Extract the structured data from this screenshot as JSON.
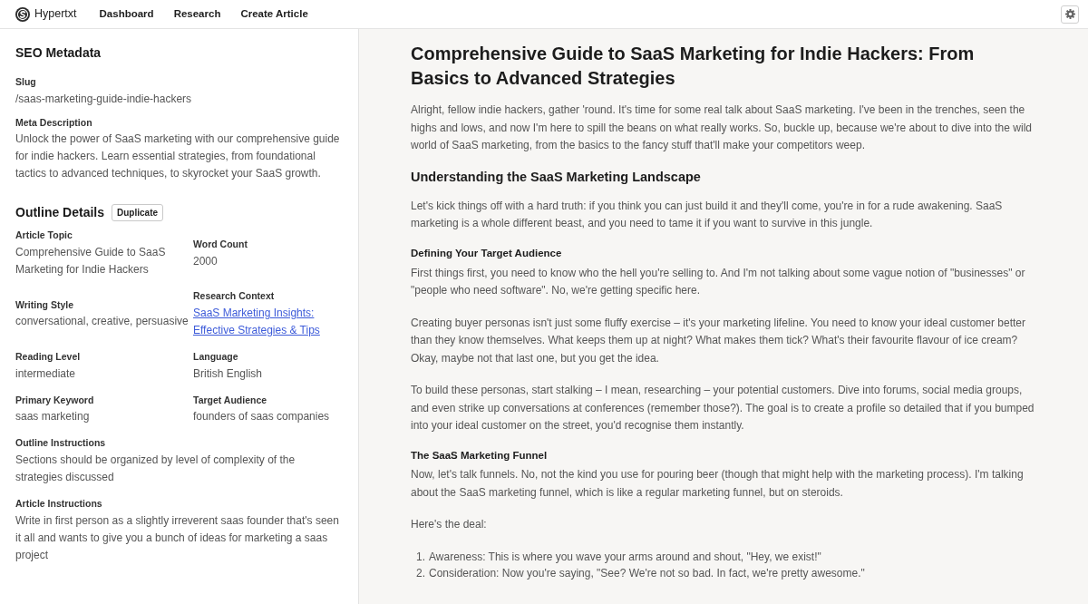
{
  "navbar": {
    "brand": "Hypertxt",
    "links": [
      {
        "label": "Dashboard"
      },
      {
        "label": "Research"
      },
      {
        "label": "Create Article"
      }
    ]
  },
  "seo_metadata": {
    "title": "SEO Metadata",
    "fields": [
      {
        "label": "Slug",
        "value": "/saas-marketing-guide-indie-hackers",
        "kind": "text"
      },
      {
        "label": "Meta Description",
        "value": "Unlock the power of SaaS marketing with our comprehensive guide for indie hackers. Learn essential strategies, from foundational tactics to advanced techniques, to skyrocket your SaaS growth.",
        "kind": "text"
      }
    ]
  },
  "outline_details": {
    "title": "Outline Details",
    "action": "Duplicate",
    "rows": [
      {
        "fields": [
          {
            "label": "Article Topic",
            "value": "Comprehensive Guide to SaaS Marketing for Indie Hackers",
            "kind": "text"
          },
          {
            "label": "Word Count",
            "value": "2000",
            "kind": "text"
          }
        ]
      },
      {
        "fields": [
          {
            "label": "Writing Style",
            "value": "conversational, creative, persuasive",
            "kind": "text"
          },
          {
            "label": "Research Context",
            "value": "SaaS Marketing Insights: Effective Strategies & Tips",
            "kind": "link"
          }
        ]
      },
      {
        "fields": [
          {
            "label": "Reading Level",
            "value": "intermediate",
            "kind": "text"
          },
          {
            "label": "Language",
            "value": "British English",
            "kind": "text"
          }
        ]
      },
      {
        "fields": [
          {
            "label": "Primary Keyword",
            "value": "saas marketing",
            "kind": "text"
          },
          {
            "label": "Target Audience",
            "value": "founders of saas companies",
            "kind": "text"
          }
        ]
      },
      {
        "fields": [
          {
            "label": "Outline Instructions",
            "value": "Sections should be organized by level of complexity of the strategies discussed",
            "kind": "text"
          }
        ]
      },
      {
        "fields": [
          {
            "label": "Article Instructions",
            "value": "Write in first person as a slightly irreverent saas founder that's seen it all and wants to give you a bunch of ideas for marketing a saas project",
            "kind": "text"
          }
        ]
      }
    ]
  },
  "article": {
    "title": "Comprehensive Guide to SaaS Marketing for Indie Hackers: From Basics to Advanced Strategies",
    "blocks": [
      {
        "kind": "paragraph",
        "text": "Alright, fellow indie hackers, gather 'round. It's time for some real talk about SaaS marketing. I've been in the trenches, seen the highs and lows, and now I'm here to spill the beans on what really works. So, buckle up, because we're about to dive into the wild world of SaaS marketing, from the basics to the fancy stuff that'll make your competitors weep."
      },
      {
        "kind": "heading",
        "text": "Understanding the SaaS Marketing Landscape"
      },
      {
        "kind": "paragraph",
        "text": "Let's kick things off with a hard truth: if you think you can just build it and they'll come, you're in for a rude awakening. SaaS marketing is a whole different beast, and you need to tame it if you want to survive in this jungle."
      },
      {
        "kind": "subheading",
        "text": "Defining Your Target Audience"
      },
      {
        "kind": "paragraph",
        "text": "First things first, you need to know who the hell you're selling to. And I'm not talking about some vague notion of \"businesses\" or \"people who need software\". No, we're getting specific here."
      },
      {
        "kind": "paragraph",
        "text": "Creating buyer personas isn't just some fluffy exercise – it's your marketing lifeline. You need to know your ideal customer better than they know themselves. What keeps them up at night? What makes them tick? What's their favourite flavour of ice cream? Okay, maybe not that last one, but you get the idea."
      },
      {
        "kind": "paragraph",
        "text": "To build these personas, start stalking – I mean, researching – your potential customers. Dive into forums, social media groups, and even strike up conversations at conferences (remember those?). The goal is to create a profile so detailed that if you bumped into your ideal customer on the street, you'd recognise them instantly."
      },
      {
        "kind": "subheading",
        "text": "The SaaS Marketing Funnel"
      },
      {
        "kind": "paragraph",
        "text": "Now, let's talk funnels. No, not the kind you use for pouring beer (though that might help with the marketing process). I'm talking about the SaaS marketing funnel, which is like a regular marketing funnel, but on steroids."
      },
      {
        "kind": "paragraph",
        "text": "Here's the deal:"
      },
      {
        "kind": "list",
        "items": [
          {
            "marker": "1.",
            "text": "Awareness: This is where you wave your arms around and shout, \"Hey, we exist!\""
          },
          {
            "marker": "2.",
            "text": "Consideration: Now you're saying, \"See? We're not so bad. In fact, we're pretty awesome.\""
          }
        ]
      }
    ]
  }
}
